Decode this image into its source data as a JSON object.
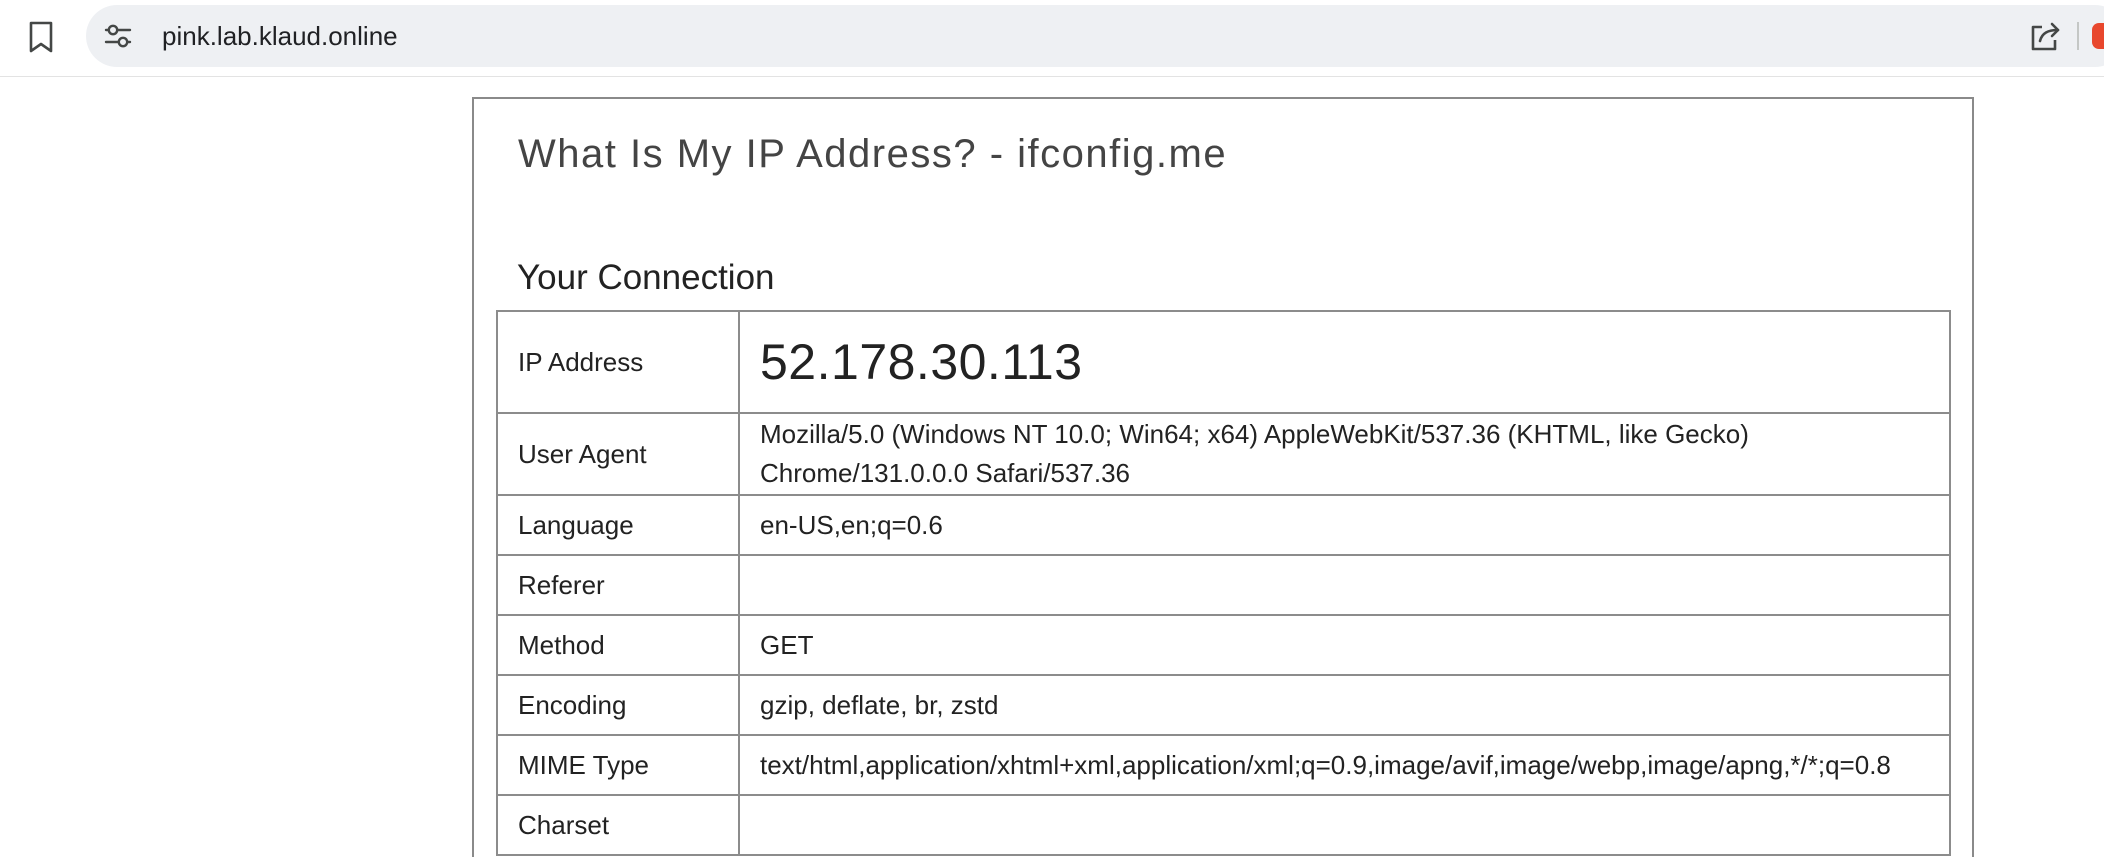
{
  "browser": {
    "url": "pink.lab.klaud.online",
    "accent_color": "#e8472d"
  },
  "page": {
    "title": "What Is My IP Address? - ifconfig.me",
    "section_heading": "Your Connection",
    "rows": [
      {
        "key": "IP Address",
        "value": "52.178.30.113"
      },
      {
        "key": "User Agent",
        "value": "Mozilla/5.0 (Windows NT 10.0; Win64; x64) AppleWebKit/537.36 (KHTML, like Gecko) Chrome/131.0.0.0 Safari/537.36"
      },
      {
        "key": "Language",
        "value": "en-US,en;q=0.6"
      },
      {
        "key": "Referer",
        "value": ""
      },
      {
        "key": "Method",
        "value": "GET"
      },
      {
        "key": "Encoding",
        "value": "gzip, deflate, br, zstd"
      },
      {
        "key": "MIME Type",
        "value": "text/html,application/xhtml+xml,application/xml;q=0.9,image/avif,image/webp,image/apng,*/*;q=0.8"
      },
      {
        "key": "Charset",
        "value": ""
      }
    ]
  },
  "icons": {
    "bookmark": "bookmark-icon",
    "site_settings": "tune-icon",
    "share": "share-icon"
  }
}
